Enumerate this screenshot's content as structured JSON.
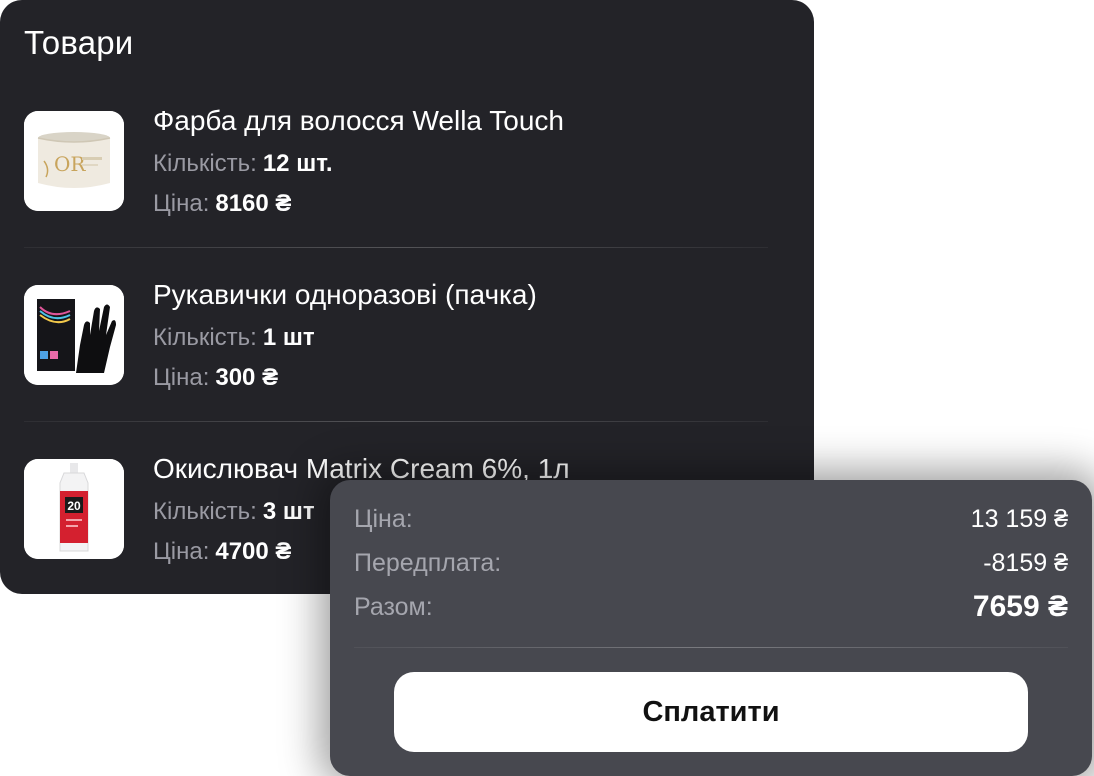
{
  "products": {
    "title": "Товари",
    "quantity_label": "Кількість:",
    "price_label": "Ціна:",
    "items": [
      {
        "name": "Фарба для волосся Wella Touch",
        "quantity": "12 шт.",
        "price": "8160 ₴",
        "image_icon": "hair-dye-jar-icon"
      },
      {
        "name": "Рукавички одноразові (пачка)",
        "quantity": "1 шт",
        "price": "300 ₴",
        "image_icon": "black-gloves-box-icon"
      },
      {
        "name": "Окислювач Matrix Cream 6%, 1л",
        "quantity": "3 шт",
        "price": "4700 ₴",
        "image_icon": "oxidant-bottle-icon"
      }
    ]
  },
  "summary": {
    "price_label": "Ціна:",
    "price_value": "13 159 ₴",
    "prepayment_label": "Передплата:",
    "prepayment_value": "-8159 ₴",
    "total_label": "Разом:",
    "total_value": "7659 ₴",
    "pay_button_label": "Сплатити"
  },
  "colors": {
    "products_card_bg": "#232328",
    "summary_card_bg": "#47484f",
    "muted_text": "#9a9aa3",
    "button_bg": "#ffffff"
  }
}
